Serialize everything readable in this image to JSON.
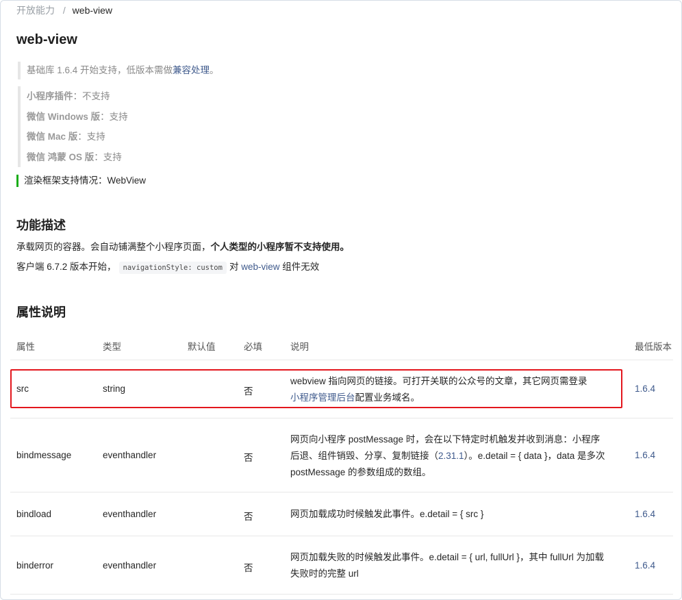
{
  "breadcrumb": {
    "parent": "开放能力",
    "separator": "/",
    "current": "web-view"
  },
  "page_title": "web-view",
  "base_lib": {
    "prefix": "基础库 1.6.4 开始支持，低版本需做",
    "link": "兼容处理",
    "suffix": "。"
  },
  "support": [
    {
      "label": "小程序插件",
      "value": "：不支持"
    },
    {
      "label": "微信 Windows 版",
      "value": "：支持"
    },
    {
      "label": "微信 Mac 版",
      "value": "：支持"
    },
    {
      "label": "微信 鸿蒙 OS 版",
      "value": "：支持"
    }
  ],
  "render_framework": "渲染框架支持情况：WebView",
  "description": {
    "heading": "功能描述",
    "line1_normal": "承载网页的容器。会自动铺满整个小程序页面，",
    "line1_bold": "个人类型的小程序暂不支持使用。",
    "line2_prefix": "客户端 6.7.2 版本开始，",
    "line2_code": "navigationStyle: custom",
    "line2_mid": "对",
    "line2_link": "web-view",
    "line2_suffix": "组件无效"
  },
  "attributes": {
    "heading": "属性说明",
    "headers": [
      "属性",
      "类型",
      "默认值",
      "必填",
      "说明",
      "最低版本"
    ],
    "rows": [
      {
        "name": "src",
        "type": "string",
        "default": "",
        "required": "否",
        "desc_text": "webview 指向网页的链接。可打开关联的公众号的文章，其它网页需登录",
        "desc_link": "小程序管理后台",
        "desc_after": "配置业务域名。",
        "version": "1.6.4"
      },
      {
        "name": "bindmessage",
        "type": "eventhandler",
        "default": "",
        "required": "否",
        "desc_text": "网页向小程序 postMessage 时，会在以下特定时机触发并收到消息：小程序后退、组件销毁、分享、复制链接（",
        "desc_link": "2.31.1",
        "desc_after": "）。e.detail = { data }，data 是多次 postMessage 的参数组成的数组。",
        "version": "1.6.4"
      },
      {
        "name": "bindload",
        "type": "eventhandler",
        "default": "",
        "required": "否",
        "desc_text": "网页加载成功时候触发此事件。e.detail = { src }",
        "version": "1.6.4"
      },
      {
        "name": "binderror",
        "type": "eventhandler",
        "default": "",
        "required": "否",
        "desc_text": "网页加载失败的时候触发此事件。e.detail = { url, fullUrl }，其中 fullUrl 为加载失败时的完整 url",
        "version": "1.6.4"
      }
    ]
  },
  "colors": {
    "link": "#3f5a8c",
    "highlight_border": "#e3161d",
    "render_bar": "#1aad19"
  }
}
